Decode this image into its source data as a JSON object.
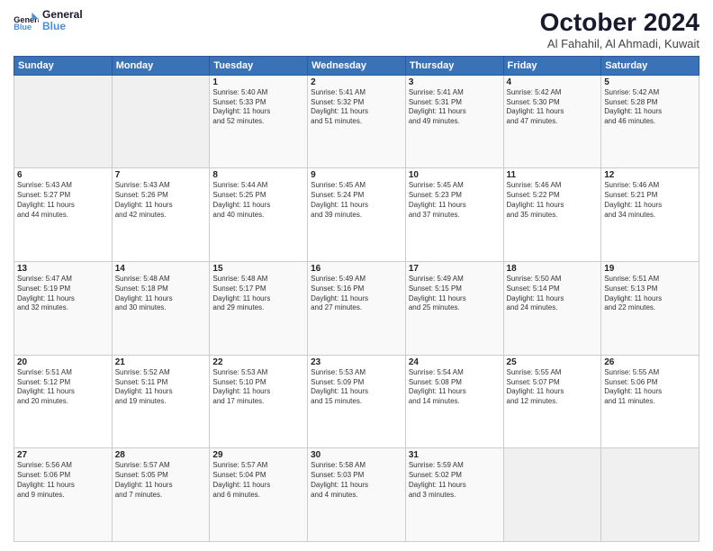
{
  "header": {
    "title": "October 2024",
    "subtitle": "Al Fahahil, Al Ahmadi, Kuwait"
  },
  "calendar": {
    "days": [
      "Sunday",
      "Monday",
      "Tuesday",
      "Wednesday",
      "Thursday",
      "Friday",
      "Saturday"
    ]
  },
  "weeks": [
    [
      {
        "day": "",
        "info": ""
      },
      {
        "day": "",
        "info": ""
      },
      {
        "day": "1",
        "info": "Sunrise: 5:40 AM\nSunset: 5:33 PM\nDaylight: 11 hours\nand 52 minutes."
      },
      {
        "day": "2",
        "info": "Sunrise: 5:41 AM\nSunset: 5:32 PM\nDaylight: 11 hours\nand 51 minutes."
      },
      {
        "day": "3",
        "info": "Sunrise: 5:41 AM\nSunset: 5:31 PM\nDaylight: 11 hours\nand 49 minutes."
      },
      {
        "day": "4",
        "info": "Sunrise: 5:42 AM\nSunset: 5:30 PM\nDaylight: 11 hours\nand 47 minutes."
      },
      {
        "day": "5",
        "info": "Sunrise: 5:42 AM\nSunset: 5:28 PM\nDaylight: 11 hours\nand 46 minutes."
      }
    ],
    [
      {
        "day": "6",
        "info": "Sunrise: 5:43 AM\nSunset: 5:27 PM\nDaylight: 11 hours\nand 44 minutes."
      },
      {
        "day": "7",
        "info": "Sunrise: 5:43 AM\nSunset: 5:26 PM\nDaylight: 11 hours\nand 42 minutes."
      },
      {
        "day": "8",
        "info": "Sunrise: 5:44 AM\nSunset: 5:25 PM\nDaylight: 11 hours\nand 40 minutes."
      },
      {
        "day": "9",
        "info": "Sunrise: 5:45 AM\nSunset: 5:24 PM\nDaylight: 11 hours\nand 39 minutes."
      },
      {
        "day": "10",
        "info": "Sunrise: 5:45 AM\nSunset: 5:23 PM\nDaylight: 11 hours\nand 37 minutes."
      },
      {
        "day": "11",
        "info": "Sunrise: 5:46 AM\nSunset: 5:22 PM\nDaylight: 11 hours\nand 35 minutes."
      },
      {
        "day": "12",
        "info": "Sunrise: 5:46 AM\nSunset: 5:21 PM\nDaylight: 11 hours\nand 34 minutes."
      }
    ],
    [
      {
        "day": "13",
        "info": "Sunrise: 5:47 AM\nSunset: 5:19 PM\nDaylight: 11 hours\nand 32 minutes."
      },
      {
        "day": "14",
        "info": "Sunrise: 5:48 AM\nSunset: 5:18 PM\nDaylight: 11 hours\nand 30 minutes."
      },
      {
        "day": "15",
        "info": "Sunrise: 5:48 AM\nSunset: 5:17 PM\nDaylight: 11 hours\nand 29 minutes."
      },
      {
        "day": "16",
        "info": "Sunrise: 5:49 AM\nSunset: 5:16 PM\nDaylight: 11 hours\nand 27 minutes."
      },
      {
        "day": "17",
        "info": "Sunrise: 5:49 AM\nSunset: 5:15 PM\nDaylight: 11 hours\nand 25 minutes."
      },
      {
        "day": "18",
        "info": "Sunrise: 5:50 AM\nSunset: 5:14 PM\nDaylight: 11 hours\nand 24 minutes."
      },
      {
        "day": "19",
        "info": "Sunrise: 5:51 AM\nSunset: 5:13 PM\nDaylight: 11 hours\nand 22 minutes."
      }
    ],
    [
      {
        "day": "20",
        "info": "Sunrise: 5:51 AM\nSunset: 5:12 PM\nDaylight: 11 hours\nand 20 minutes."
      },
      {
        "day": "21",
        "info": "Sunrise: 5:52 AM\nSunset: 5:11 PM\nDaylight: 11 hours\nand 19 minutes."
      },
      {
        "day": "22",
        "info": "Sunrise: 5:53 AM\nSunset: 5:10 PM\nDaylight: 11 hours\nand 17 minutes."
      },
      {
        "day": "23",
        "info": "Sunrise: 5:53 AM\nSunset: 5:09 PM\nDaylight: 11 hours\nand 15 minutes."
      },
      {
        "day": "24",
        "info": "Sunrise: 5:54 AM\nSunset: 5:08 PM\nDaylight: 11 hours\nand 14 minutes."
      },
      {
        "day": "25",
        "info": "Sunrise: 5:55 AM\nSunset: 5:07 PM\nDaylight: 11 hours\nand 12 minutes."
      },
      {
        "day": "26",
        "info": "Sunrise: 5:55 AM\nSunset: 5:06 PM\nDaylight: 11 hours\nand 11 minutes."
      }
    ],
    [
      {
        "day": "27",
        "info": "Sunrise: 5:56 AM\nSunset: 5:06 PM\nDaylight: 11 hours\nand 9 minutes."
      },
      {
        "day": "28",
        "info": "Sunrise: 5:57 AM\nSunset: 5:05 PM\nDaylight: 11 hours\nand 7 minutes."
      },
      {
        "day": "29",
        "info": "Sunrise: 5:57 AM\nSunset: 5:04 PM\nDaylight: 11 hours\nand 6 minutes."
      },
      {
        "day": "30",
        "info": "Sunrise: 5:58 AM\nSunset: 5:03 PM\nDaylight: 11 hours\nand 4 minutes."
      },
      {
        "day": "31",
        "info": "Sunrise: 5:59 AM\nSunset: 5:02 PM\nDaylight: 11 hours\nand 3 minutes."
      },
      {
        "day": "",
        "info": ""
      },
      {
        "day": "",
        "info": ""
      }
    ]
  ]
}
